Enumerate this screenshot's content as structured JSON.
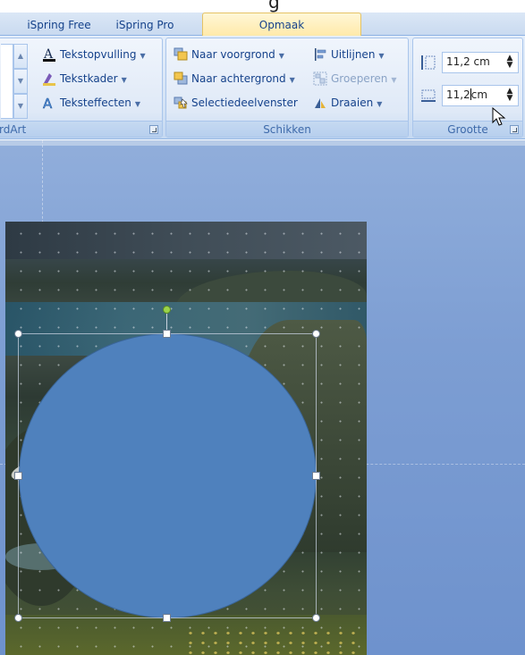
{
  "tabs": {
    "ispring_free": "iSpring Free",
    "ispring_pro": "iSpring Pro",
    "opmaak": "Opmaak"
  },
  "wordart_group": {
    "label": "rdArt",
    "tekstopvulling": "Tekstopvulling",
    "tekstkader": "Tekstkader",
    "teksteffecten": "Teksteffecten"
  },
  "schikken_group": {
    "label": "Schikken",
    "naar_voorgrond": "Naar voorgrond",
    "naar_achtergrond": "Naar achtergrond",
    "selectiedeelvenster": "Selectiedeelvenster",
    "uitlijnen": "Uitlijnen",
    "groeperen": "Groeperen",
    "draaien": "Draaien"
  },
  "grootte_group": {
    "label": "Grootte",
    "height_value": "11,2 cm",
    "width_value_before_cursor": "11,2",
    "width_value_after_cursor": "cm"
  },
  "icons": {
    "tekstopvulling": "text-fill-icon",
    "tekstkader": "text-outline-icon",
    "teksteffecten": "text-effects-icon",
    "naar_voorgrond": "bring-forward-icon",
    "naar_achtergrond": "send-backward-icon",
    "selectiedeelvenster": "selection-pane-icon",
    "uitlijnen": "align-icon",
    "groeperen": "group-icon",
    "draaien": "rotate-icon",
    "height": "shape-height-icon",
    "width": "shape-width-icon",
    "cursor": "mouse-pointer-icon"
  },
  "colors": {
    "shape_fill": "#4f81bd",
    "contextual_tab": "#ffe9a8",
    "rotation_handle": "#9bd34a"
  }
}
